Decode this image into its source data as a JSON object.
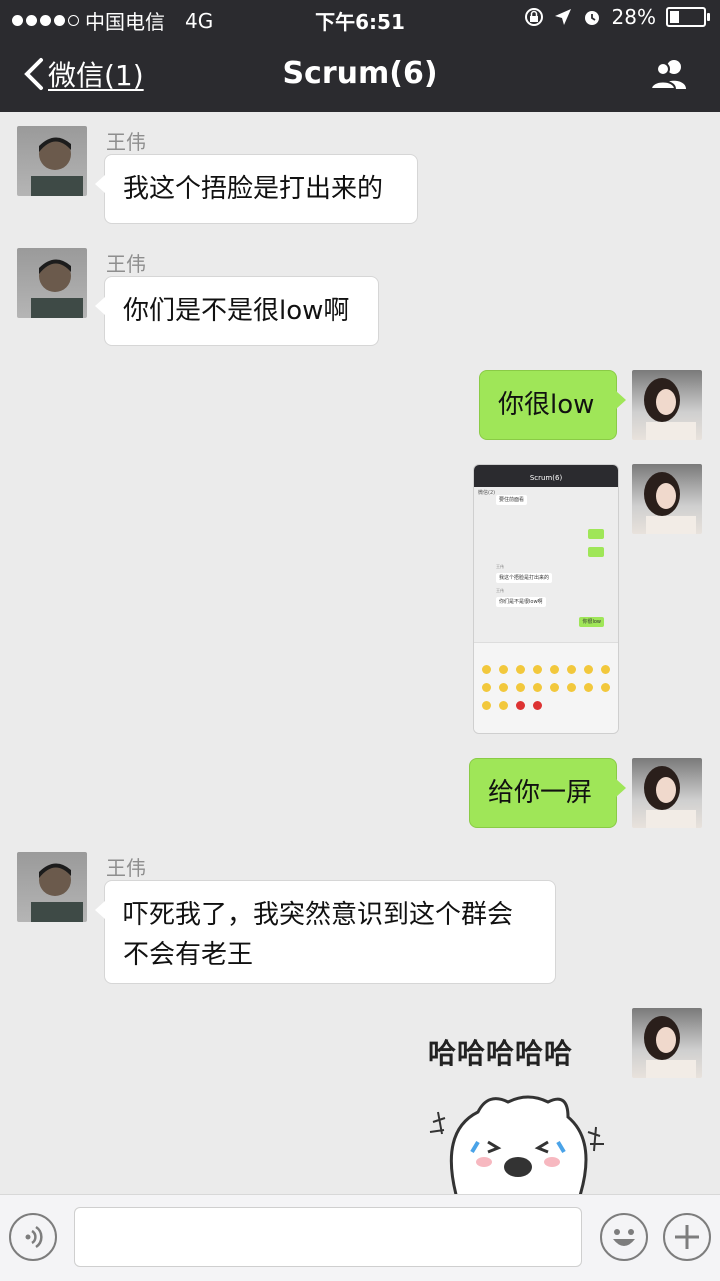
{
  "status_bar": {
    "carrier": "中国电信",
    "network": "4G",
    "time": "下午6:51",
    "battery": "28%",
    "battery_level": 0.28
  },
  "nav": {
    "back_label": "微信(1)",
    "title": "Scrum(6)"
  },
  "messages": [
    {
      "sender": "王伟",
      "text": "我这个捂脸是打出来的",
      "direction": "in"
    },
    {
      "sender": "王伟",
      "text": "你们是不是很low啊",
      "direction": "in"
    },
    {
      "text": "你很low",
      "direction": "out"
    },
    {
      "type": "image",
      "direction": "out",
      "image": {
        "title": "Scrum(6)",
        "back": "微信(2)",
        "lines": [
          "要住前面看",
          "王伟",
          "我这个捂脸是打出来的",
          "王伟",
          "你们是不是很low啊",
          "你很low"
        ]
      }
    },
    {
      "text": "给你一屏",
      "direction": "out"
    },
    {
      "sender": "王伟",
      "text": "吓死我了，我突然意识到这个群会不会有老王",
      "direction": "in"
    },
    {
      "type": "sticker",
      "direction": "out",
      "sticker": {
        "text": "哈哈哈哈哈"
      }
    }
  ],
  "colors": {
    "out_bubble": "#9fe658",
    "header": "#2b2b2f",
    "background": "#ebebeb"
  },
  "icons": [
    "back-chevron-icon",
    "group-members-icon",
    "voice-icon",
    "emoji-icon",
    "plus-icon",
    "location-icon",
    "alarm-icon",
    "lock-rotation-icon"
  ]
}
